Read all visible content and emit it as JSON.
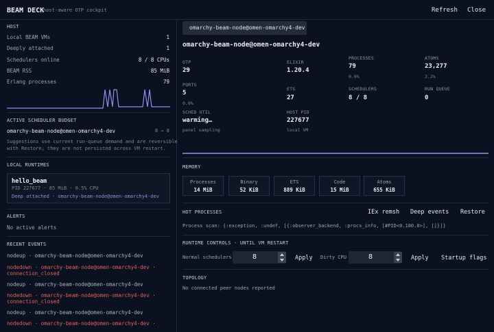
{
  "header": {
    "title": "BEAM DECK",
    "subtitle": "host-aware OTP cockpit",
    "refresh_label": "Refresh",
    "close_label": "Close"
  },
  "host": {
    "section_label": "HOST",
    "rows": [
      {
        "label": "Local BEAM VMs",
        "value": "1"
      },
      {
        "label": "Deeply attached",
        "value": "1"
      },
      {
        "label": "Schedulers online",
        "value": "8 / 8 CPUs"
      },
      {
        "label": "BEAM RSS",
        "value": "85 MiB"
      },
      {
        "label": "Erlang processes",
        "value": "79"
      }
    ]
  },
  "budget": {
    "section_label": "ACTIVE SCHEDULER BUDGET",
    "node": "omarchy-beam-node@omen-omarchy4-dev",
    "value": "8 → 8",
    "note_line1": "Suggestions use current run-queue demand and are reversible",
    "note_line2": "with Restore; they are not persisted across VM restart."
  },
  "local_runtimes": {
    "section_label": "LOCAL RUNTIMES",
    "card": {
      "name": "hello_beam",
      "info": "PID 227677 · 85 MiB · 0.5% CPU",
      "link": "Deep attached · omarchy-beam-node@omen-omarchy4-dev"
    }
  },
  "alerts": {
    "section_label": "ALERTS",
    "empty": "No active alerts"
  },
  "events": {
    "section_label": "RECENT EVENTS",
    "items": [
      {
        "kind": "ok",
        "line1": "nodeup  ·  omarchy-beam-node@omen-omarchy4-dev",
        "line2": ""
      },
      {
        "kind": "down",
        "line1": "nodedown  ·  omarchy-beam-node@omen-omarchy4-dev  ·",
        "line2": "connection_closed"
      },
      {
        "kind": "ok",
        "line1": "nodeup  ·  omarchy-beam-node@omen-omarchy4-dev",
        "line2": ""
      },
      {
        "kind": "down",
        "line1": "nodedown  ·  omarchy-beam-node@omen-omarchy4-dev  ·",
        "line2": "connection_closed"
      },
      {
        "kind": "ok",
        "line1": "nodeup  ·  omarchy-beam-node@omen-omarchy4-dev",
        "line2": ""
      },
      {
        "kind": "down",
        "line1": "nodedown  ·  omarchy-beam-node@omen-omarchy4-dev  ·",
        "line2": ""
      }
    ]
  },
  "node": {
    "tag": "omarchy-beam-node@omen-omarchy4-dev",
    "title": "omarchy-beam-node@omen-omarchy4-dev",
    "metrics": {
      "otp": {
        "label": "OTP",
        "value": "29"
      },
      "elixir": {
        "label": "ELIXIR",
        "value": "1.20.4"
      },
      "processes": {
        "label": "PROCESSES",
        "value": "79",
        "sub": "0.0%"
      },
      "atoms": {
        "label": "ATOMS",
        "value": "23,277",
        "sub": "2.2%"
      },
      "ports": {
        "label": "PORTS",
        "value": "5",
        "sub": "0.0%"
      },
      "ets": {
        "label": "ETS",
        "value": "27"
      },
      "schedulers": {
        "label": "SCHEDULERS",
        "value": "8 / 8"
      },
      "run_queue": {
        "label": "RUN QUEUE",
        "value": "0"
      },
      "sched_util": {
        "label": "SCHED UTIL",
        "value": "warming…",
        "sub": "panel sampling"
      },
      "host_pid": {
        "label": "HOST PID",
        "value": "227677",
        "sub": "local VM"
      }
    }
  },
  "memory": {
    "section_label": "MEMORY",
    "items": [
      {
        "label": "Processes",
        "value": "14 MiB"
      },
      {
        "label": "Binary",
        "value": "52 KiB"
      },
      {
        "label": "ETS",
        "value": "889 KiB"
      },
      {
        "label": "Code",
        "value": "15 MiB"
      },
      {
        "label": "Atoms",
        "value": "655 KiB"
      }
    ]
  },
  "hot_processes": {
    "section_label": "HOT PROCESSES",
    "iex_label": "IEx remsh",
    "deep_label": "Deep events",
    "restore_label": "Restore",
    "scan_text": "Process scan: {:exception, :undef, [{:observer_backend, :procs_info, [#PID<0.180.0>], []}]}"
  },
  "runtime_controls": {
    "section_label": "RUNTIME CONTROLS · UNTIL VM RESTART",
    "normal_label": "Normal schedulers",
    "normal_value": "8",
    "apply1": "Apply",
    "dirty_label": "Dirty CPU",
    "dirty_value": "8",
    "apply2": "Apply",
    "startup_label": "Startup flags"
  },
  "topology": {
    "section_label": "TOPOLOGY",
    "empty": "No connected peer nodes reported"
  },
  "colors": {
    "background": "#0b1120",
    "sparkline": "#8f8ff0",
    "event_down": "#e0635c",
    "link": "#8c8fd9"
  }
}
